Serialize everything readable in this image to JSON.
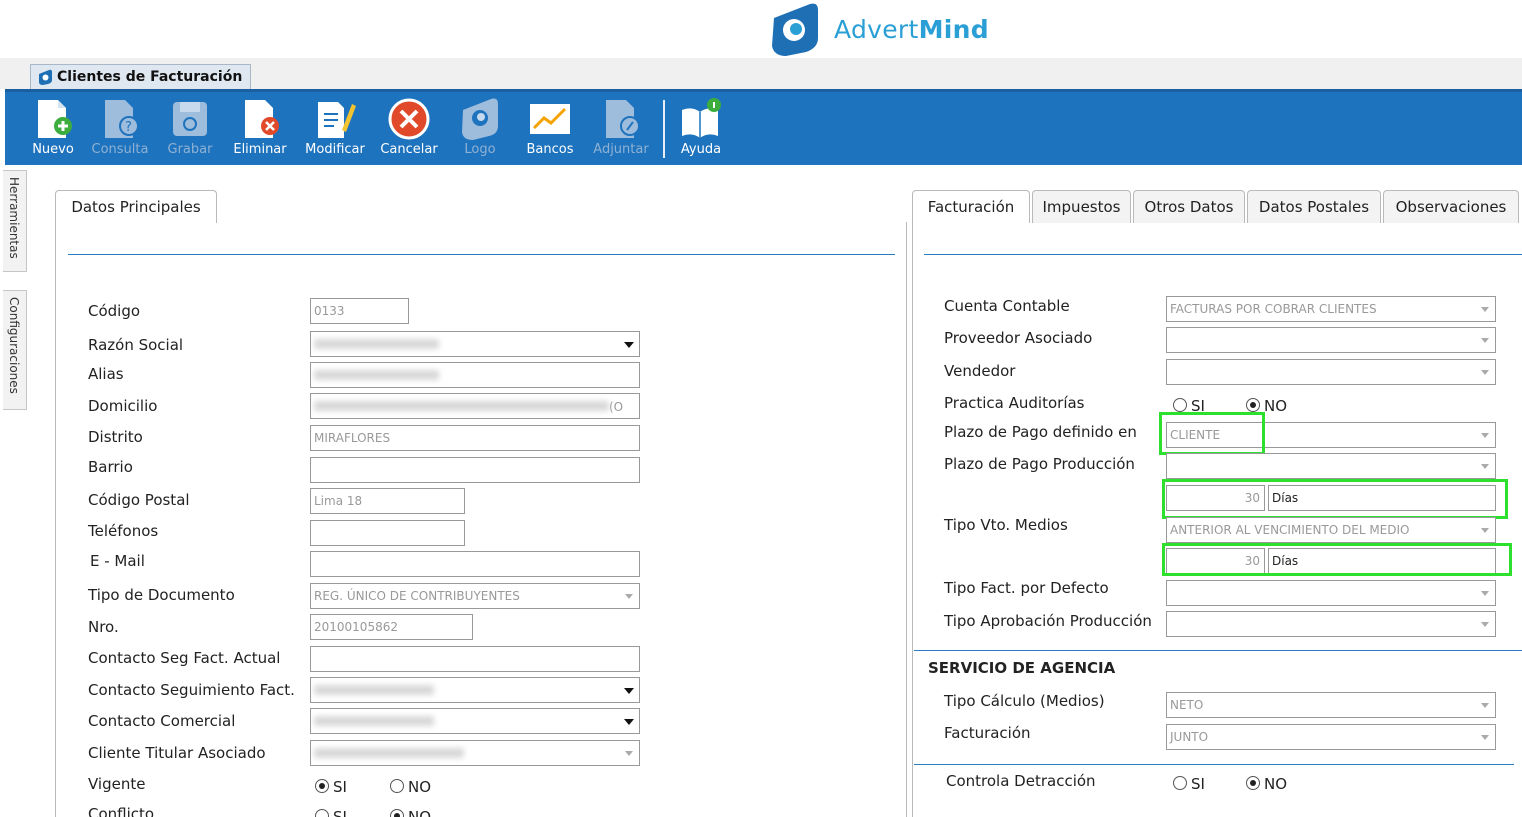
{
  "brand": {
    "name_regular": "Advert",
    "name_bold": "Mind"
  },
  "app_tab": {
    "label": "Clientes de Facturación"
  },
  "toolbar": {
    "buttons": [
      {
        "label": "Nuevo"
      },
      {
        "label": "Consulta"
      },
      {
        "label": "Grabar"
      },
      {
        "label": "Eliminar"
      },
      {
        "label": "Modificar"
      },
      {
        "label": "Cancelar"
      },
      {
        "label": "Logo"
      },
      {
        "label": "Bancos"
      },
      {
        "label": "Adjuntar"
      },
      {
        "label": "Ayuda"
      }
    ]
  },
  "side_tabs": {
    "tools": "Herramientas",
    "config": "Configuraciones"
  },
  "left": {
    "tab": "Datos Principales",
    "labels": {
      "codigo": "Código",
      "razon": "Razón Social",
      "alias": "Alias",
      "domicilio": "Domicilio",
      "distrito": "Distrito",
      "barrio": "Barrio",
      "postal": "Código Postal",
      "telefonos": "Teléfonos",
      "email": "E - Mail",
      "tipo_doc": "Tipo de Documento",
      "nro": "Nro.",
      "contacto_seg_actual": "Contacto Seg Fact. Actual",
      "contacto_seg": "Contacto Seguimiento Fact.",
      "contacto_com": "Contacto Comercial",
      "cliente_titular": "Cliente Titular Asociado",
      "vigente": "Vigente",
      "conflicto": "Conflicto"
    },
    "values": {
      "codigo": "0133",
      "domicilio_tail": "(O",
      "distrito": "MIRAFLORES",
      "postal": "Lima 18",
      "tipo_doc": "REG. ÚNICO DE CONTRIBUYENTES",
      "nro": "20100105862"
    },
    "radio": {
      "si": "SI",
      "no": "NO"
    }
  },
  "right": {
    "tabs": [
      "Facturación",
      "Impuestos",
      "Otros Datos",
      "Datos Postales",
      "Observaciones"
    ],
    "labels": {
      "cuenta": "Cuenta Contable",
      "proveedor": "Proveedor Asociado",
      "vendedor": "Vendedor",
      "auditorias": "Practica Auditorías",
      "plazo_def": "Plazo de Pago definido en",
      "plazo_prod": "Plazo de Pago Producción",
      "tipo_vto": "Tipo Vto. Medios",
      "tipo_fact": "Tipo Fact. por Defecto",
      "tipo_aprob": "Tipo Aprobación Producción",
      "servicio": "SERVICIO DE AGENCIA",
      "tipo_calc": "Tipo Cálculo (Medios)",
      "facturacion": "Facturación",
      "detraccion": "Controla Detracción"
    },
    "values": {
      "cuenta": "FACTURAS POR COBRAR CLIENTES",
      "plazo_def": "CLIENTE",
      "dias_num_1": "30",
      "dias_unit_1": "Días",
      "tipo_vto": "ANTERIOR AL VENCIMIENTO DEL MEDIO",
      "dias_num_2": "30",
      "dias_unit_2": "Días",
      "tipo_calc": "NETO",
      "facturacion": "JUNTO"
    },
    "radio": {
      "si": "SI",
      "no": "NO"
    }
  },
  "colors": {
    "toolbar": "#1e73be",
    "highlight": "#2ee02e",
    "brand": "#2a9fd6"
  }
}
